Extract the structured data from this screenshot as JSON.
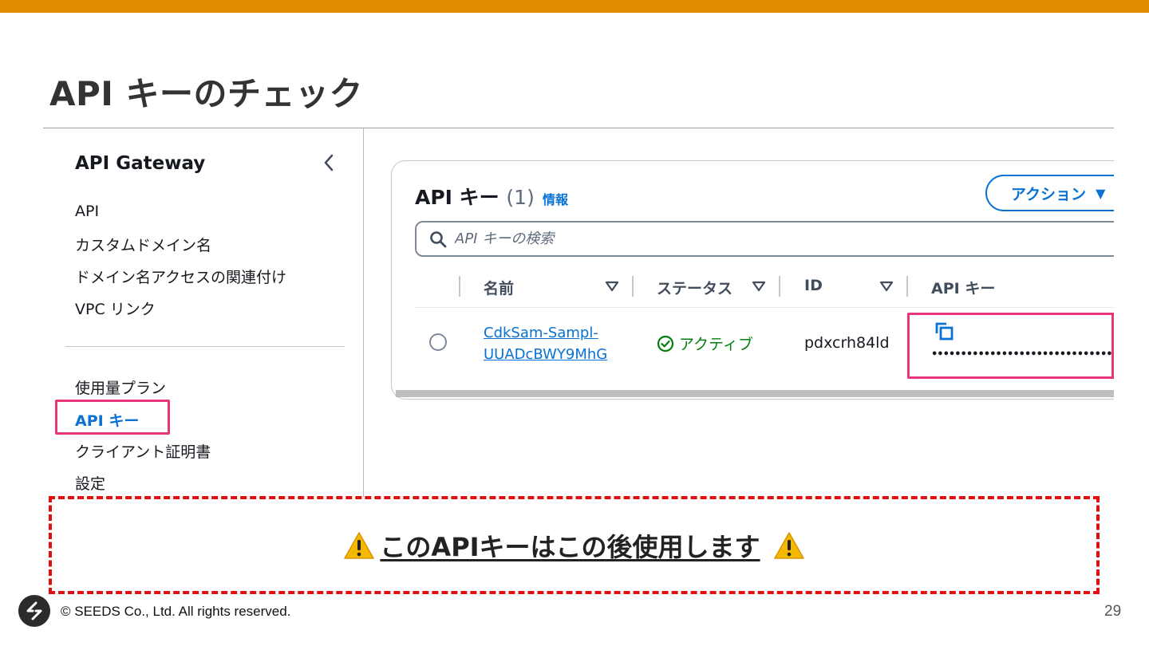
{
  "slide": {
    "title": "API キーのチェック",
    "page_number": "29",
    "copyright": "© SEEDS Co., Ltd. All rights reserved.",
    "accent_color": "#e38c00"
  },
  "sidebar": {
    "title": "API Gateway",
    "collapse_icon": "chevron-left-icon",
    "items_top": [
      {
        "label": "API"
      },
      {
        "label": "カスタムドメイン名"
      },
      {
        "label": "ドメイン名アクセスの関連付け"
      },
      {
        "label": "VPC リンク"
      }
    ],
    "items_bottom": [
      {
        "label": "使用量プラン"
      },
      {
        "label": "API キー",
        "active": true
      },
      {
        "label": "クライアント証明書"
      },
      {
        "label": "設定"
      }
    ]
  },
  "panel": {
    "title": "API キー",
    "count": "(1)",
    "info_link": "情報",
    "actions_label": "アクション",
    "search_placeholder": "API キーの検索",
    "columns": [
      "名前",
      "ステータス",
      "ID",
      "API キー"
    ],
    "rows": [
      {
        "name_line1": "CdkSam-Sampl-",
        "name_line2": "UUADcBWY9MhG",
        "status": "アクティブ",
        "status_color": "#037f0c",
        "id": "pdxcrh84ld",
        "api_key_masked": "••••••••••••••••••••••••••••••••••••"
      }
    ]
  },
  "notice": {
    "text": "このAPIキーはこの後使用します",
    "icon": "warning-icon",
    "border_color": "#e01010"
  },
  "highlight_color": "#e8357a"
}
